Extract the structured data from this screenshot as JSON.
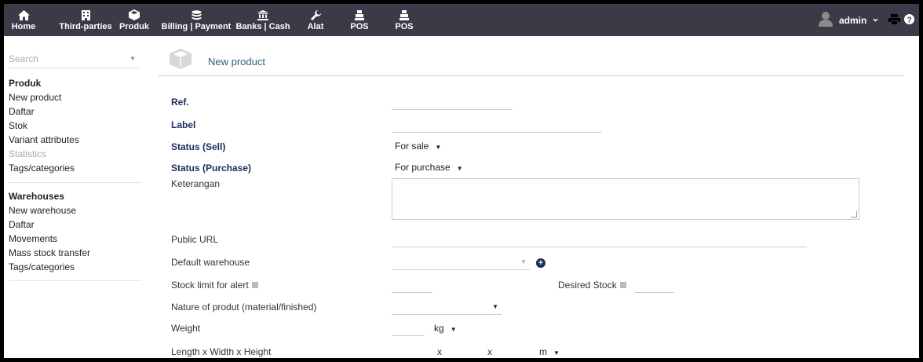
{
  "topnav": {
    "items": [
      {
        "label": "Home",
        "icon": "home-icon"
      },
      {
        "label": "Third-parties",
        "icon": "building-icon"
      },
      {
        "label": "Produk",
        "icon": "cube-icon"
      },
      {
        "label": "Billing | Payment",
        "icon": "coins-icon"
      },
      {
        "label": "Banks | Cash",
        "icon": "bank-icon"
      },
      {
        "label": "Alat",
        "icon": "wrench-icon"
      },
      {
        "label": "POS",
        "icon": "cash-register-icon"
      },
      {
        "label": "POS",
        "icon": "cash-register-icon"
      }
    ],
    "user": "admin",
    "user_caret": "⌄",
    "bar_color": "#3b3b48"
  },
  "sidebar": {
    "search_placeholder": "Search",
    "product_section": {
      "title": "Produk",
      "items": [
        "New product",
        "Daftar",
        "Stok",
        "Variant attributes",
        "Statistics",
        "Tags/categories"
      ]
    },
    "warehouse_section": {
      "title": "Warehouses",
      "items": [
        "New warehouse",
        "Daftar",
        "Movements",
        "Mass stock transfer",
        "Tags/categories"
      ]
    }
  },
  "form": {
    "page_title": "New product",
    "ref_label": "Ref.",
    "label_label": "Label",
    "status_sell_label": "Status (Sell)",
    "status_sell_value": "For sale",
    "status_purchase_label": "Status (Purchase)",
    "status_purchase_value": "For purchase",
    "description_label": "Keterangan",
    "public_url_label": "Public URL",
    "default_warehouse_label": "Default warehouse",
    "stock_limit_label": "Stock limit for alert",
    "desired_stock_label": "Desired Stock",
    "nature_label": "Nature of produt (material/finished)",
    "weight_label": "Weight",
    "weight_unit": "kg",
    "dimensions_label": "Length x Width x Height",
    "dim_sep": "x",
    "dim_unit": "m"
  }
}
